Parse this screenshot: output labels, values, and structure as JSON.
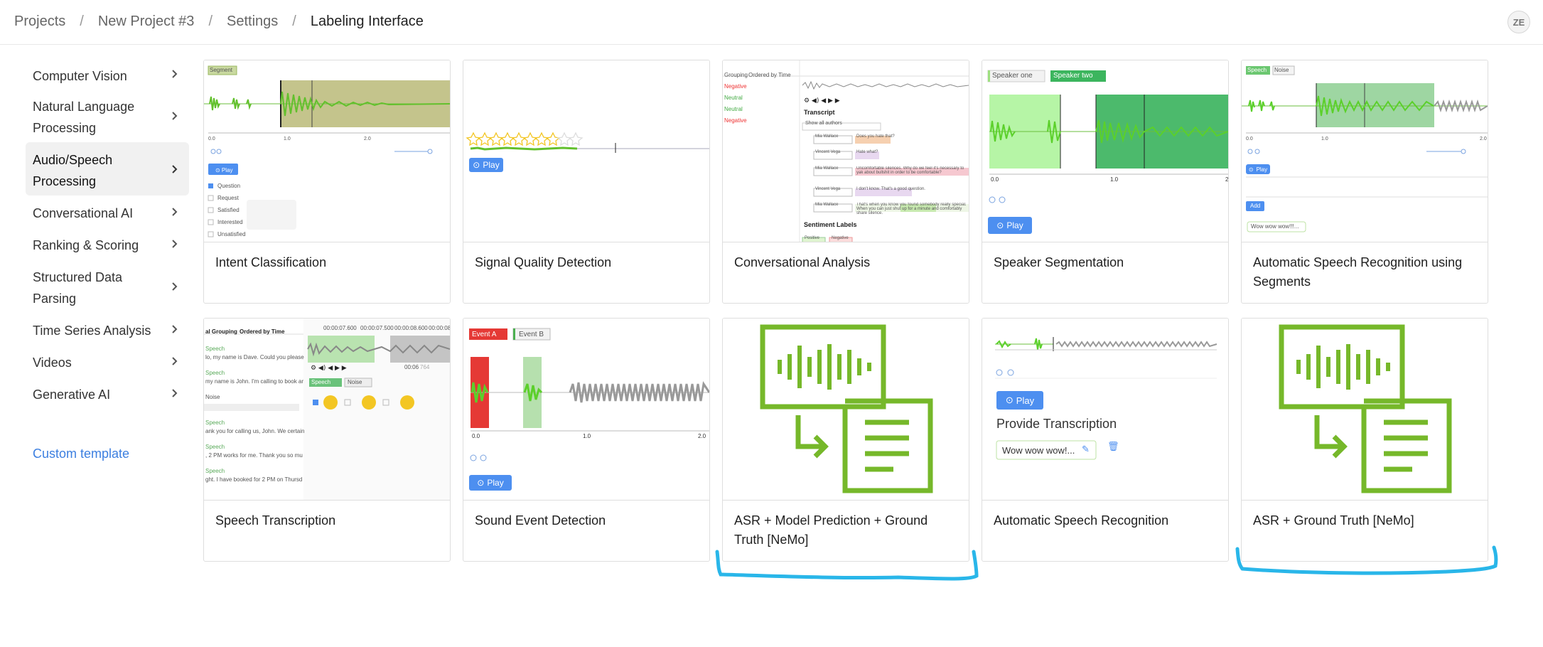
{
  "breadcrumb": [
    "Projects",
    "New Project #3",
    "Settings",
    "Labeling Interface"
  ],
  "user_initials": "ZE",
  "sidebar": {
    "items": [
      {
        "label": "Computer Vision",
        "active": false
      },
      {
        "label": "Natural Language Processing",
        "active": false
      },
      {
        "label": "Audio/Speech Processing",
        "active": true
      },
      {
        "label": "Conversational AI",
        "active": false
      },
      {
        "label": "Ranking & Scoring",
        "active": false
      },
      {
        "label": "Structured Data Parsing",
        "active": false
      },
      {
        "label": "Time Series Analysis",
        "active": false
      },
      {
        "label": "Videos",
        "active": false
      },
      {
        "label": "Generative AI",
        "active": false
      }
    ],
    "custom_template": "Custom template"
  },
  "templates": [
    {
      "title": "Intent Classification",
      "icon": "intent-preview"
    },
    {
      "title": "Signal Quality Detection",
      "icon": "signal-preview"
    },
    {
      "title": "Conversational Analysis",
      "icon": "conversation-preview"
    },
    {
      "title": "Speaker Segmentation",
      "icon": "speaker-preview"
    },
    {
      "title": "Automatic Speech Recognition using Segments",
      "icon": "asr-segments-preview"
    },
    {
      "title": "Speech Transcription",
      "icon": "transcription-preview"
    },
    {
      "title": "Sound Event Detection",
      "icon": "sound-event-preview"
    },
    {
      "title": "ASR + Model Prediction + Ground Truth [NeMo]",
      "icon": "nemo-icon"
    },
    {
      "title": "Automatic Speech Recognition",
      "icon": "asr-preview"
    },
    {
      "title": "ASR + Ground Truth [NeMo]",
      "icon": "nemo-icon"
    }
  ],
  "previews": {
    "play": "Play",
    "intent_region_label": "Segment",
    "intent_choices": [
      "Question",
      "Request",
      "Satisfied",
      "Interested",
      "Unsatisfied"
    ],
    "speaker_labels": [
      "Speaker one",
      "Speaker two"
    ],
    "asr_seg_labels": [
      "Speech",
      "Noise"
    ],
    "add": "Add",
    "asr_seg_text": "Wow wow wow!!!...",
    "event_labels": [
      "Event A",
      "Event B"
    ],
    "provide_transcription": "Provide Transcription",
    "asr_text": "Wow wow wow!...",
    "conv_header": [
      "Grouping",
      "Ordered by Time"
    ],
    "conv_transcript": "Transcript",
    "conv_show_all": "Show all authors",
    "conv_lines": [
      {
        "author": "Mia Wallace",
        "text": "Does you hate that?"
      },
      {
        "author": "Vincent Vega",
        "text": "Hate what?"
      },
      {
        "author": "Mia Wallace",
        "text": "Uncomfortable silences. Why do we feel it's necessary to yak about bullshit in order to be comfortable?"
      },
      {
        "author": "Vincent Vega",
        "text": "I don't know. That's a good question."
      },
      {
        "author": "Mia Wallace",
        "text": "That's when you know you found somebody really special. When you can just shut up for a minute and comfortably share silence."
      }
    ],
    "conv_sentiment": "Sentiment Labels",
    "conv_sentiments": [
      "Positive",
      "Negative"
    ],
    "conv_side": [
      "Negative",
      "Neutral",
      "Neutral",
      "Negative"
    ],
    "trans_header": [
      "al Grouping",
      "Ordered by Time"
    ],
    "trans_lines": [
      {
        "who": "Speech",
        "text": "lo, my name is Dave. Could you please"
      },
      {
        "who": "Speech",
        "text": "my name is John. I'm calling to book ar"
      },
      {
        "who": "",
        "text": "Noise"
      },
      {
        "who": "Speech",
        "text": "ank you for calling us, John. We certain"
      },
      {
        "who": "Speech",
        "text": ", 2 PM works for me. Thank you so mu"
      },
      {
        "who": "Speech",
        "text": "ght. I have booked for 2 PM on Thursd"
      }
    ],
    "trans_tags": [
      "Speech",
      "Noise"
    ],
    "time_ticks": [
      "00:00:07.600",
      "00:00:07.500",
      "00:00:08.600",
      "00:00:08.800"
    ],
    "time_now": "00:06",
    "time_total": "764",
    "axis_ticks": [
      "0.0",
      "1.0",
      "2.0"
    ]
  }
}
